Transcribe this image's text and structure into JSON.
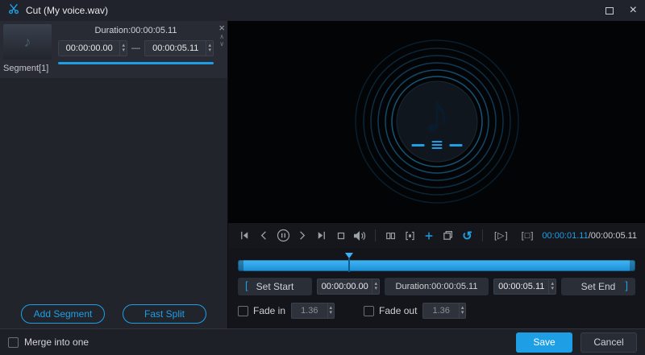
{
  "titlebar": {
    "title": "Cut (My voice.wav)"
  },
  "glyphs": {
    "close": "×",
    "spin_up": "▴",
    "spin_down": "▾",
    "chevron_up": "∧",
    "chevron_down": "∨",
    "dash": "—",
    "note": "♪",
    "thumb_note": "♪",
    "reset": "↺",
    "clip_play": "[▷]",
    "clip_stop": "[□]"
  },
  "segment_panel": {
    "duration_label": "Duration:00:00:05.11",
    "start_value": "00:00:00.00",
    "end_value": "00:00:05.11",
    "segment_name": "Segment[1]",
    "add_segment_label": "Add Segment",
    "fast_split_label": "Fast Split"
  },
  "toolbar_icons": [
    "skip-start",
    "step-back",
    "pause",
    "step-forward",
    "skip-end",
    "stop",
    "volume",
    "split-segment",
    "frame-cut",
    "add",
    "copy",
    "reset",
    "clip-play",
    "clip-stop"
  ],
  "player_toolbar": {
    "time_current": "00:00:01.11",
    "time_total": "/00:00:05.11"
  },
  "timeline": {
    "playhead_percent": 28
  },
  "cut_controls": {
    "bracket_left": "[",
    "bracket_right": "]",
    "set_start_label": "Set Start",
    "start_value": "00:00:00.00",
    "duration_label": "Duration:00:00:05.11",
    "end_value": "00:00:05.11",
    "set_end_label": "Set End",
    "fade_in_label": "Fade in",
    "fade_in_value": "1.36",
    "fade_out_label": "Fade out",
    "fade_out_value": "1.36"
  },
  "footer": {
    "merge_label": "Merge into one",
    "save_label": "Save",
    "cancel_label": "Cancel"
  },
  "colors": {
    "accent": "#1e9fe5"
  }
}
